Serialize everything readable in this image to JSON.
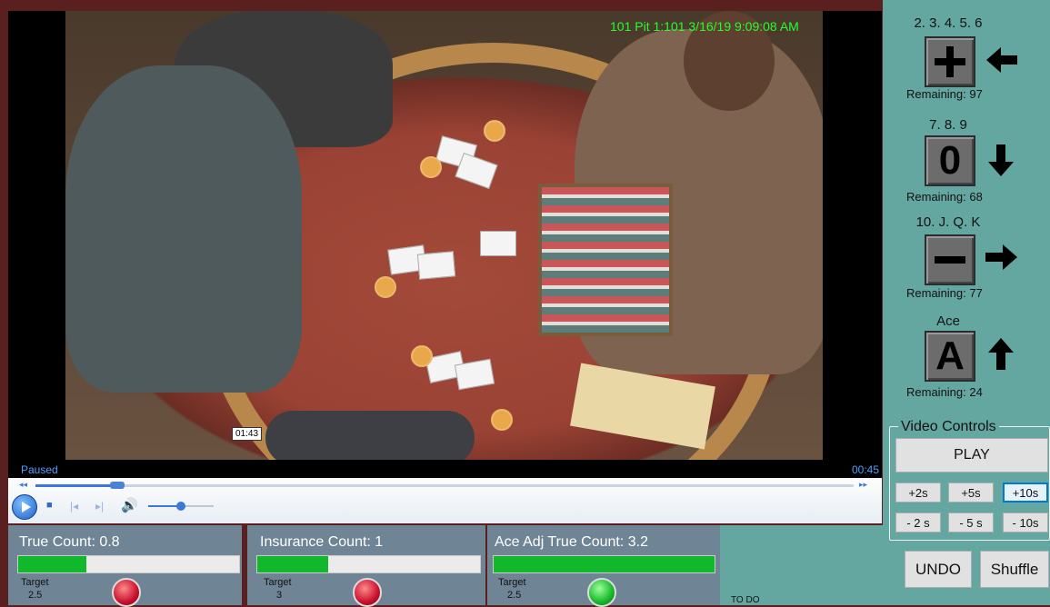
{
  "video": {
    "camera_stamp": "101 Pit 1:101  3/16/19 9:09:08 AM",
    "clip_marker": "01:43",
    "status": "Paused",
    "elapsed": "00:45",
    "seek_progress": 0.1,
    "volume_level": 0.5
  },
  "counters": [
    {
      "title": "True Count: 0.8",
      "fill": 0.31,
      "target_label": "Target",
      "target_value": "2.5",
      "light": "red"
    },
    {
      "title": "Insurance Count: 1",
      "fill": 0.32,
      "target_label": "Target",
      "target_value": "3",
      "light": "red"
    },
    {
      "title": "Ace Adj True Count: 3.2",
      "fill": 1.0,
      "target_label": "Target",
      "target_value": "2.5",
      "light": "green"
    }
  ],
  "todo": "TO DO",
  "card_groups": [
    {
      "label": "2. 3. 4. 5. 6",
      "symbol": "plus-icon",
      "arrow": "arrow-left-icon",
      "remaining": "Remaining: 97"
    },
    {
      "label": "7. 8. 9",
      "symbol": "0",
      "arrow": "arrow-down-icon",
      "remaining": "Remaining: 68"
    },
    {
      "label": "10. J. Q. K",
      "symbol": "minus-icon",
      "arrow": "arrow-right-icon",
      "remaining": "Remaining: 77"
    },
    {
      "label": "Ace",
      "symbol": "A",
      "arrow": "arrow-up-icon",
      "remaining": "Remaining: 24"
    }
  ],
  "video_controls": {
    "title": "Video Controls",
    "play": "PLAY",
    "forward": [
      "+2s",
      "+5s",
      "+10s"
    ],
    "back": [
      "- 2 s",
      "- 5 s",
      "- 10s"
    ],
    "selected": "+10s"
  },
  "actions": {
    "undo": "UNDO",
    "shuffle": "Shuffle"
  },
  "colors": {
    "sidebar": "#64a6a0",
    "panel": "#6f8596",
    "bar_fill": "#12b82c",
    "stamp": "#23ff2a",
    "frame": "#5a1f1f"
  }
}
